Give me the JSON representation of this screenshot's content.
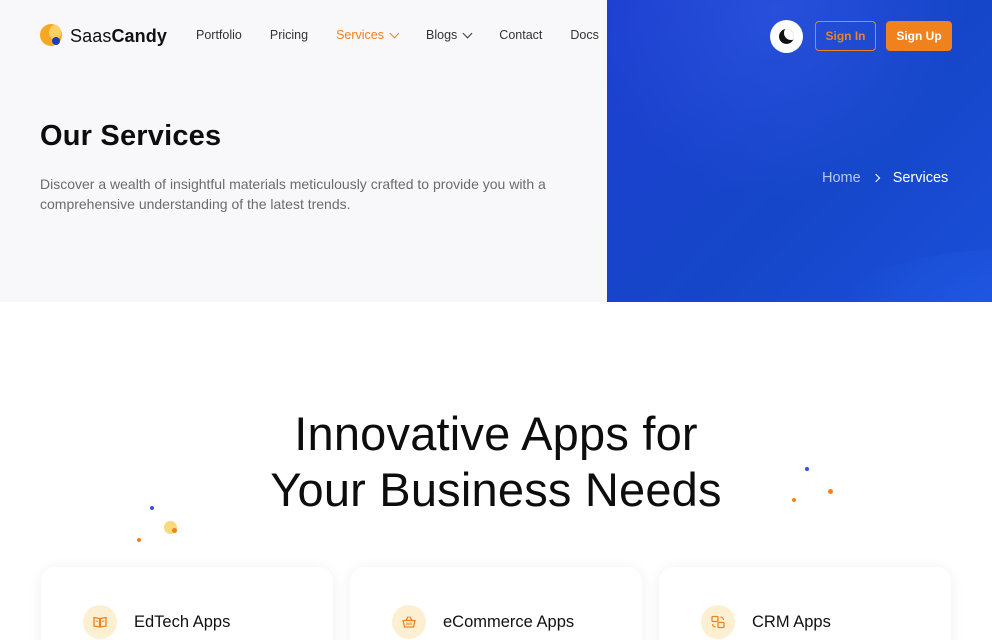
{
  "brand": {
    "name_light": "Saas",
    "name_bold": "Candy"
  },
  "nav": {
    "items": [
      {
        "label": "Portfolio",
        "has_dropdown": false,
        "active": false
      },
      {
        "label": "Pricing",
        "has_dropdown": false,
        "active": false
      },
      {
        "label": "Services",
        "has_dropdown": true,
        "active": true
      },
      {
        "label": "Blogs",
        "has_dropdown": true,
        "active": false
      },
      {
        "label": "Contact",
        "has_dropdown": false,
        "active": false
      },
      {
        "label": "Docs",
        "has_dropdown": false,
        "active": false
      }
    ]
  },
  "header_actions": {
    "theme_toggle_icon": "moon-icon",
    "sign_in_label": "Sign In",
    "sign_up_label": "Sign Up"
  },
  "hero": {
    "title": "Our Services",
    "description": "Discover a wealth of insightful materials meticulously crafted to provide you with a comprehensive understanding of the latest trends."
  },
  "breadcrumb": {
    "home": "Home",
    "current": "Services"
  },
  "section": {
    "title_line1": "Innovative Apps for",
    "title_line2": "Your Business Needs"
  },
  "cards": [
    {
      "title": "EdTech Apps",
      "icon": "book-icon"
    },
    {
      "title": "eCommerce Apps",
      "icon": "basket-icon"
    },
    {
      "title": "CRM Apps",
      "icon": "crm-icon"
    }
  ],
  "colors": {
    "accent": "#f0821e",
    "hero_blue": "#1546c9",
    "icon_bg": "#fdf0d2"
  }
}
